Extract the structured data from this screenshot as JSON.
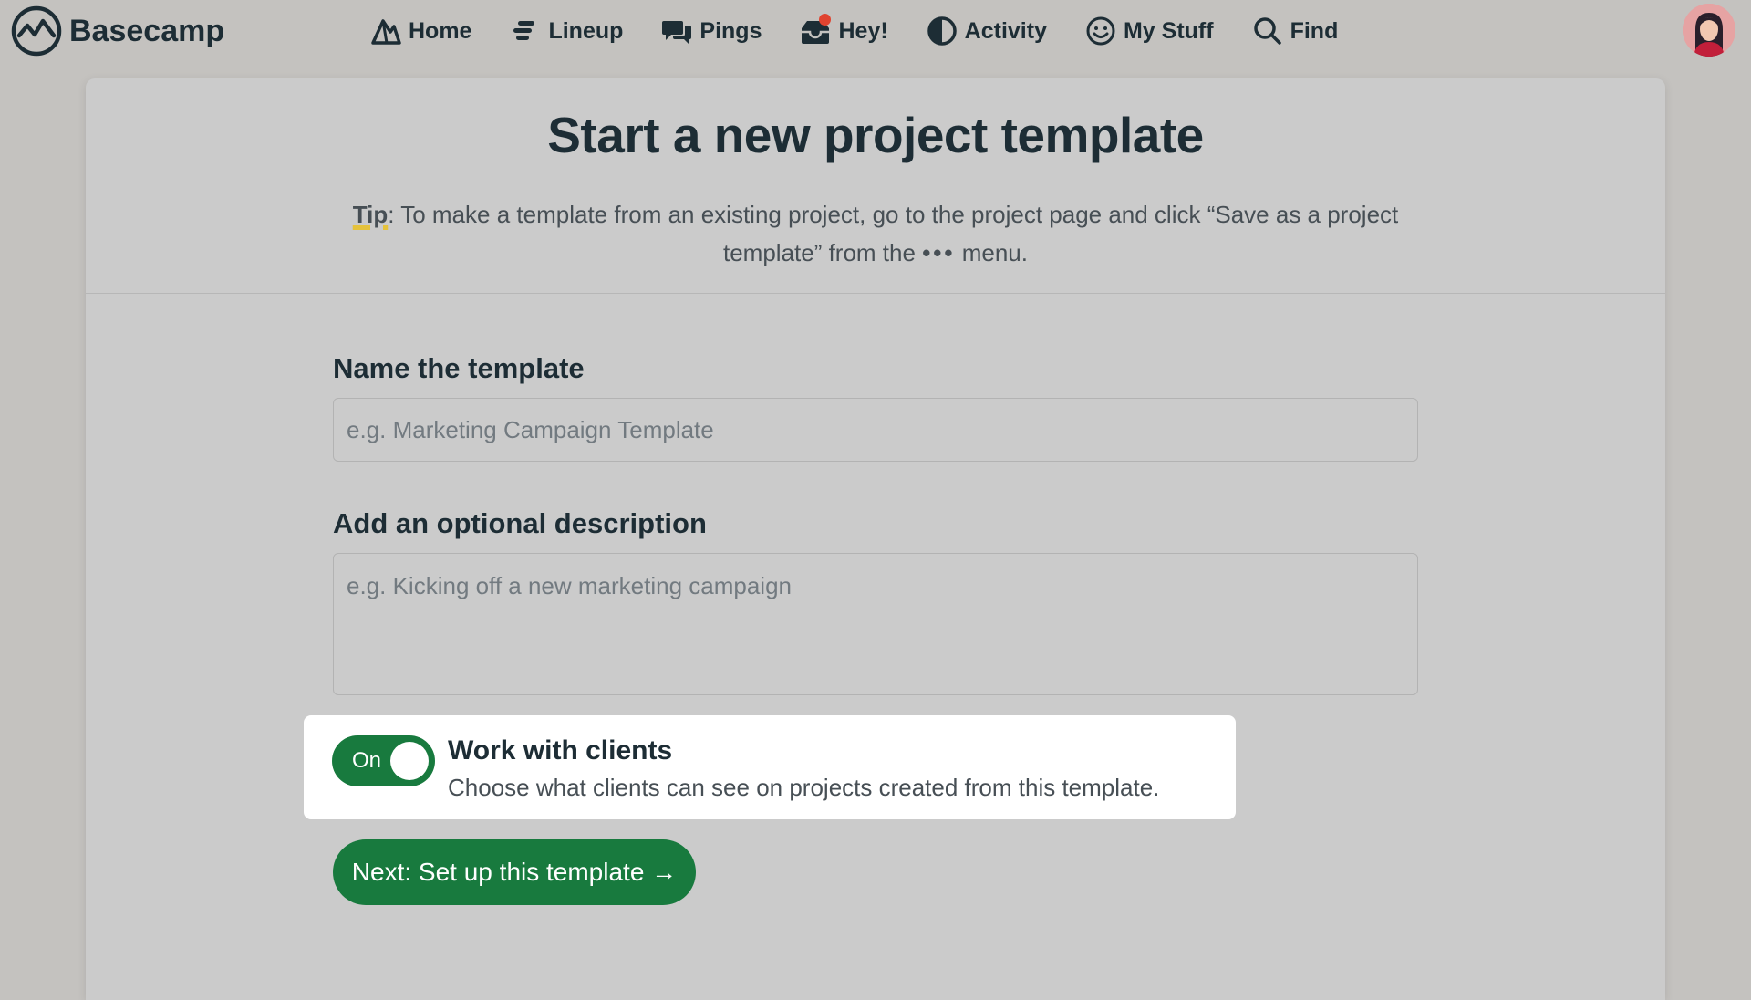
{
  "app": {
    "name": "Basecamp"
  },
  "nav": {
    "items": [
      {
        "label": "Home",
        "icon": "home-icon"
      },
      {
        "label": "Lineup",
        "icon": "lineup-icon"
      },
      {
        "label": "Pings",
        "icon": "pings-icon"
      },
      {
        "label": "Hey!",
        "icon": "hey-icon",
        "has_unread": true
      },
      {
        "label": "Activity",
        "icon": "activity-icon"
      },
      {
        "label": "My Stuff",
        "icon": "my-stuff-icon"
      },
      {
        "label": "Find",
        "icon": "search-icon"
      }
    ]
  },
  "page": {
    "title": "Start a new project template",
    "tip_label": "Tip",
    "tip_text_before": ": To make a template from an existing project, go to the project page and click “Save as a project template” from the ",
    "tip_dots": "•••",
    "tip_text_after": " menu."
  },
  "form": {
    "name_label": "Name the template",
    "name_value": "",
    "name_placeholder": "e.g. Marketing Campaign Template",
    "description_label": "Add an optional description",
    "description_value": "",
    "description_placeholder": "e.g. Kicking off a new marketing campaign"
  },
  "clients": {
    "toggle_label": "On",
    "toggle_state": true,
    "title": "Work with clients",
    "description": "Choose what clients can see on projects created from this template."
  },
  "actions": {
    "next_label": "Next: Set up this template →"
  },
  "colors": {
    "brand_green": "#187a3e",
    "notification_red": "#e0432f",
    "tip_highlight": "#e5c23c"
  }
}
